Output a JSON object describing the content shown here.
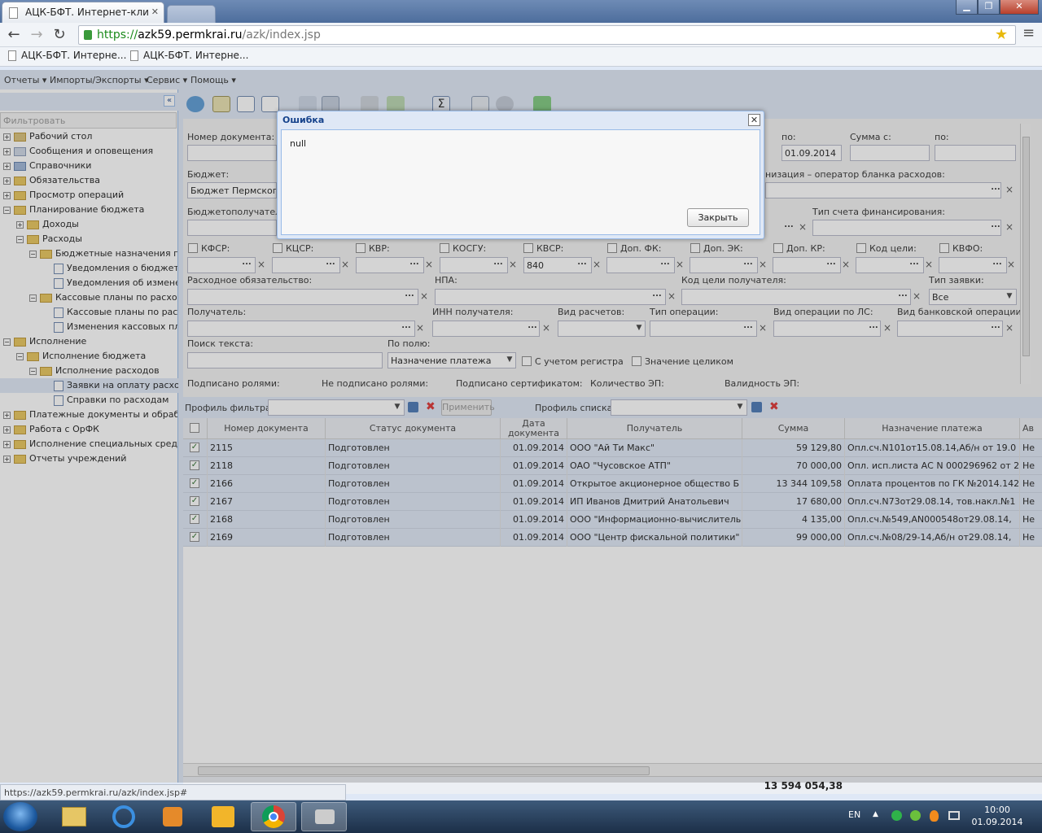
{
  "browser": {
    "tabs": [
      {
        "title": "АЦК-БФТ. Интернет-кли"
      }
    ],
    "url_scheme": "https://",
    "url_host": "azk59.permkrai.ru",
    "url_path": "/azk/index.jsp",
    "bookmarks": [
      "АЦК-БФТ. Интерне...",
      "АЦК-БФТ. Интерне..."
    ],
    "status_url": "https://azk59.permkrai.ru/azk/index.jsp#"
  },
  "app_menu": [
    "Отчеты",
    "Импорты/Экспорты",
    "Сервис",
    "Помощь"
  ],
  "nav": {
    "filter_placeholder": "Фильтровать",
    "items": [
      {
        "label": "Рабочий стол"
      },
      {
        "label": "Сообщения и оповещения"
      },
      {
        "label": "Справочники"
      },
      {
        "label": "Обязательства"
      },
      {
        "label": "Просмотр операций"
      },
      {
        "label": "Планирование бюджета"
      },
      {
        "label": "Доходы"
      },
      {
        "label": "Расходы"
      },
      {
        "label": "Бюджетные назначения по ра"
      },
      {
        "label": "Уведомления о бюджетны"
      },
      {
        "label": "Уведомления об изменени"
      },
      {
        "label": "Кассовые планы по расходам"
      },
      {
        "label": "Кассовые планы по расхо"
      },
      {
        "label": "Изменения кассовых план"
      },
      {
        "label": "Исполнение"
      },
      {
        "label": "Исполнение бюджета"
      },
      {
        "label": "Исполнение расходов"
      },
      {
        "label": "Заявки на оплату расходо"
      },
      {
        "label": "Справки по расходам"
      },
      {
        "label": "Платежные документы и обработка"
      },
      {
        "label": "Работа с ОрФК"
      },
      {
        "label": "Исполнение специальных средств"
      },
      {
        "label": "Отчеты учреждений"
      }
    ]
  },
  "filter": {
    "doc_number_label": "Номер документа:",
    "po_label": "по:",
    "po_date": "01.09.2014",
    "sum_from_label": "Сумма с:",
    "sum_to_label": "по:",
    "budget_label": "Бюджет:",
    "budget_value": "Бюджет Пермского к",
    "org_label": "низация – оператор бланка расходов:",
    "recipient_budget_label": "Бюджетополучатель",
    "fin_account_label": "Тип счета финансирования:",
    "codes": [
      {
        "label": "КФСР:",
        "value": ""
      },
      {
        "label": "КЦСР:",
        "value": ""
      },
      {
        "label": "КВР:",
        "value": ""
      },
      {
        "label": "КОСГУ:",
        "value": ""
      },
      {
        "label": "КВСР:",
        "value": "840"
      },
      {
        "label": "Доп. ФК:",
        "value": ""
      },
      {
        "label": "Доп. ЭК:",
        "value": ""
      },
      {
        "label": "Доп. КР:",
        "value": ""
      },
      {
        "label": "Код цели:",
        "value": ""
      },
      {
        "label": "КВФО:",
        "value": ""
      }
    ],
    "expense_obligation_label": "Расходное обязательство:",
    "npa_label": "НПА:",
    "goal_code_label": "Код цели получателя:",
    "request_type_label": "Тип заявки:",
    "request_type_value": "Все",
    "recipient_label": "Получатель:",
    "inn_label": "ИНН получателя:",
    "calc_type_label": "Вид расчетов:",
    "op_type_label": "Тип операции:",
    "op_kind_label": "Вид операции по ЛС:",
    "bank_op_label": "Вид банковской операции:",
    "text_search_label": "Поиск текста:",
    "by_field_label": "По полю:",
    "by_field_value": "Назначение платежа",
    "register_label": "С учетом регистра",
    "whole_label": "Значение целиком",
    "signed_roles_label": "Подписано ролями:",
    "unsigned_roles_label": "Не подписано ролями:",
    "signed_cert_label": "Подписано сертификатом:",
    "ep_count_label": "Количество ЭП:",
    "ep_valid_label": "Валидность ЭП:"
  },
  "profile_bar": {
    "filter_profile_label": "Профиль фильтра",
    "apply_label": "Применить",
    "list_profile_label": "Профиль списка"
  },
  "grid": {
    "columns": [
      "Номер документа",
      "Статус документа",
      "Дата документа",
      "Получатель",
      "Сумма",
      "Назначение платежа",
      "Ав"
    ],
    "date_col_line1": "Дата",
    "date_col_line2": "документа",
    "rows": [
      {
        "num": "2115",
        "status": "Подготовлен",
        "date": "01.09.2014",
        "recipient": "ООО \"Ай Ти Макс\"",
        "sum": "59 129,80",
        "purpose": "Опл.сч.N101от15.08.14,Аб/н от 19.0",
        "extra": "Не"
      },
      {
        "num": "2118",
        "status": "Подготовлен",
        "date": "01.09.2014",
        "recipient": "ОАО \"Чусовское АТП\"",
        "sum": "70 000,00",
        "purpose": "Опл. исп.листа АС N 000296962 от 2",
        "extra": "Не"
      },
      {
        "num": "2166",
        "status": "Подготовлен",
        "date": "01.09.2014",
        "recipient": "Открытое акционерное общество Б",
        "sum": "13 344 109,58",
        "purpose": "Оплата процентов по ГК №2014.142",
        "extra": "Не"
      },
      {
        "num": "2167",
        "status": "Подготовлен",
        "date": "01.09.2014",
        "recipient": "ИП Иванов Дмитрий Анатольевич",
        "sum": "17 680,00",
        "purpose": "Опл.сч.N73от29.08.14, тов.накл.№1",
        "extra": "Не"
      },
      {
        "num": "2168",
        "status": "Подготовлен",
        "date": "01.09.2014",
        "recipient": "ООО \"Информационно-вычислитель",
        "sum": "4 135,00",
        "purpose": "Опл.сч.№549,АN000548от29.08.14,",
        "extra": "Не"
      },
      {
        "num": "2169",
        "status": "Подготовлен",
        "date": "01.09.2014",
        "recipient": "ООО \"Центр фискальной политики\"",
        "sum": "99 000,00",
        "purpose": "Опл.сч.№08/29-14,Аб/н от29.08.14,",
        "extra": "Не"
      }
    ],
    "total": "13 594 054,38"
  },
  "dialog": {
    "title": "Ошибка",
    "message": "null",
    "close_label": "Закрыть"
  },
  "taskbar": {
    "lang": "EN",
    "time": "10:00",
    "date": "01.09.2014"
  }
}
